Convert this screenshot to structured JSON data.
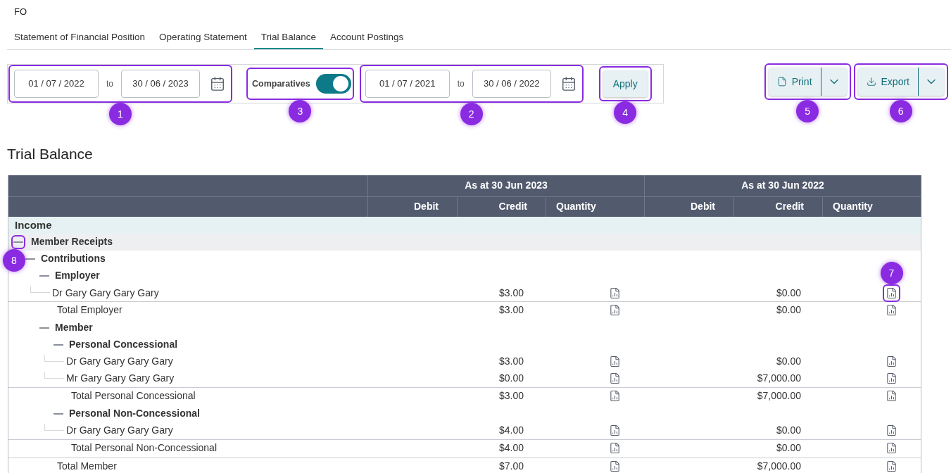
{
  "header": {
    "title": "FO"
  },
  "tabs": [
    {
      "label": "Statement of Financial Position",
      "selected": false
    },
    {
      "label": "Operating Statement",
      "selected": false
    },
    {
      "label": "Trial Balance",
      "selected": true
    },
    {
      "label": "Account Postings",
      "selected": false
    }
  ],
  "filters": {
    "period": {
      "from": "01 / 07 / 2022",
      "to_label": "to",
      "to": "30 / 06 / 2023",
      "callout": "1"
    },
    "comparatives": {
      "label": "Comparatives",
      "on": true,
      "callout": "3"
    },
    "comparative_period": {
      "from": "01 / 07 / 2021",
      "to_label": "to",
      "to": "30 / 06 / 2022",
      "callout": "2"
    },
    "apply": {
      "label": "Apply",
      "callout": "4"
    }
  },
  "actions": [
    {
      "label": "Print",
      "kind": "print",
      "callout": "5"
    },
    {
      "label": "Export",
      "kind": "export",
      "callout": "6"
    }
  ],
  "report_title": "Trial Balance",
  "table": {
    "periods": [
      {
        "title": "As at 30 Jun 2023",
        "columns": [
          "Debit",
          "Credit",
          "Quantity"
        ]
      },
      {
        "title": "As at 30 Jun 2022",
        "columns": [
          "Debit",
          "Credit",
          "Quantity"
        ]
      }
    ],
    "section": "Income",
    "rows": [
      {
        "kind": "group",
        "label": "Member Receipts",
        "expanded": true,
        "highlighted": true,
        "callout": "8",
        "children": [
          {
            "kind": "group",
            "label": "Contributions",
            "expanded": true,
            "highlighted": false,
            "children": [
              {
                "kind": "group",
                "label": "Employer",
                "expanded": true,
                "highlighted": false,
                "children": [
                  {
                    "kind": "account",
                    "label": "Dr Gary Gary Gary Gary",
                    "credits": [
                      "$3.00",
                      "$0.00"
                    ],
                    "quantity_callout": "7"
                  },
                  {
                    "kind": "total",
                    "label": "Total Employer",
                    "credits": [
                      "$3.00",
                      "$0.00"
                    ]
                  }
                ]
              },
              {
                "kind": "group",
                "label": "Member",
                "expanded": true,
                "highlighted": false,
                "children": [
                  {
                    "kind": "group",
                    "label": "Personal Concessional",
                    "expanded": true,
                    "highlighted": false,
                    "children": [
                      {
                        "kind": "account",
                        "label": "Dr Gary Gary Gary Gary",
                        "credits": [
                          "$3.00",
                          "$0.00"
                        ]
                      },
                      {
                        "kind": "account",
                        "label": "Mr Gary Gary Gary Gary",
                        "credits": [
                          "$0.00",
                          "$7,000.00"
                        ]
                      },
                      {
                        "kind": "total",
                        "label": "Total Personal Concessional",
                        "credits": [
                          "$3.00",
                          "$7,000.00"
                        ]
                      }
                    ]
                  },
                  {
                    "kind": "group",
                    "label": "Personal Non-Concessional",
                    "expanded": true,
                    "highlighted": false,
                    "children": [
                      {
                        "kind": "account",
                        "label": "Dr Gary Gary Gary Gary",
                        "credits": [
                          "$4.00",
                          "$0.00"
                        ]
                      },
                      {
                        "kind": "total",
                        "label": "Total Personal Non-Concessional",
                        "credits": [
                          "$4.00",
                          "$0.00"
                        ]
                      }
                    ]
                  },
                  {
                    "kind": "total",
                    "label": "Total Member",
                    "credits": [
                      "$7.00",
                      "$7,000.00"
                    ]
                  }
                ]
              }
            ]
          }
        ]
      }
    ]
  }
}
